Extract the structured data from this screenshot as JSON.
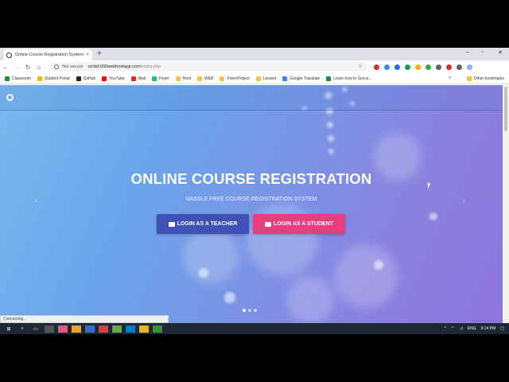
{
  "browser": {
    "tab_title": "Online Course Registration System",
    "tab_close": "×",
    "new_tab": "+",
    "window_controls": {
      "minimize": "–",
      "maximize": "▫",
      "close": "✕"
    },
    "nav": {
      "back": "←",
      "forward": "→",
      "reload": "↻",
      "home": "⌂"
    },
    "security_label": "Not secure",
    "url_host": "ocrbd.000webhostapp.com",
    "url_path": "/index.php",
    "star": "☆",
    "bookmarks": [
      {
        "label": "Classroom",
        "color": "#1e8e3e"
      },
      {
        "label": "Student Portal",
        "color": "#f4b400"
      },
      {
        "label": "GitHub",
        "color": "#222222"
      },
      {
        "label": "YouTube",
        "color": "#ff0000"
      },
      {
        "label": "Mail",
        "color": "#d93025"
      },
      {
        "label": "Fiverr",
        "color": "#1dbf73"
      },
      {
        "label": "Host",
        "color": "#f6c342"
      },
      {
        "label": "WEB",
        "color": "#f6c342"
      },
      {
        "label": "FiverrProject",
        "color": "#f6c342"
      },
      {
        "label": "Laravel",
        "color": "#f6c342"
      },
      {
        "label": "Google Translate",
        "color": "#4285f4"
      },
      {
        "label": "Learn how to Succe...",
        "color": "#1e8e3e"
      }
    ],
    "more_bookmarks": "»",
    "other_bookmarks": "Other bookmarks",
    "status_text": "Connecting...",
    "extension_colors": [
      "#d93025",
      "#4285f4",
      "#1a73e8",
      "#0f9d58",
      "#f4b400",
      "#34a853",
      "#5f6368",
      "#d93025",
      "#5f6368",
      "#8ab4f8"
    ]
  },
  "page": {
    "hero_title": "ONLINE COURSE REGISTRATION",
    "hero_subtitle": "HASSLE FREE COURSE REGISTRATION SYSTEM",
    "teacher_button": "LOGIN AS A TEACHER",
    "student_button": "LOGIN AS A STUDENT",
    "prev_arrow": "‹",
    "next_arrow": "›",
    "carousel_slides": 3,
    "active_slide": 1,
    "colors": {
      "teacher": "#3f51b5",
      "student": "#e83e7b"
    }
  },
  "taskbar": {
    "start_icon": "windows-icon",
    "tray_language": "ENG",
    "clock": "9:14 PM"
  }
}
